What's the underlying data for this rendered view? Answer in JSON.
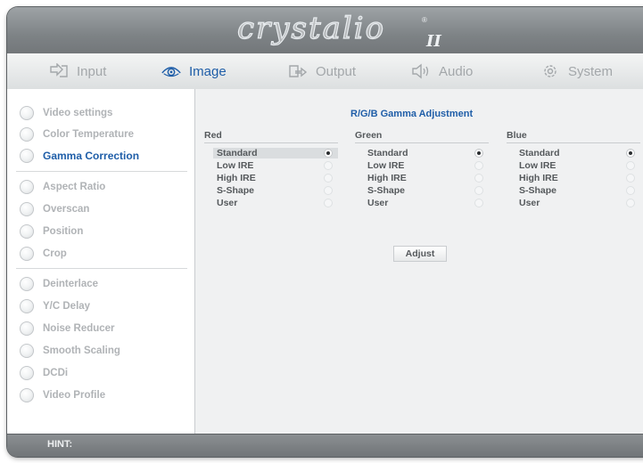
{
  "brand": {
    "logo": "crystalio",
    "logo_mark": "®",
    "logo_sub": "II"
  },
  "tabs": [
    {
      "label": "Input",
      "icon": "input-icon",
      "active": false
    },
    {
      "label": "Image",
      "icon": "eye-icon",
      "active": true
    },
    {
      "label": "Output",
      "icon": "output-icon",
      "active": false
    },
    {
      "label": "Audio",
      "icon": "speaker-icon",
      "active": false
    },
    {
      "label": "System",
      "icon": "gear-icon",
      "active": false
    }
  ],
  "sidebar": {
    "items": [
      {
        "label": "Video settings",
        "active": false
      },
      {
        "label": "Color Temperature",
        "active": false
      },
      {
        "label": "Gamma Correction",
        "active": true
      },
      {
        "label": "Aspect Ratio",
        "active": false
      },
      {
        "label": "Overscan",
        "active": false
      },
      {
        "label": "Position",
        "active": false
      },
      {
        "label": "Crop",
        "active": false
      },
      {
        "label": "Deinterlace",
        "active": false
      },
      {
        "label": "Y/C Delay",
        "active": false
      },
      {
        "label": "Noise Reducer",
        "active": false
      },
      {
        "label": "Smooth Scaling",
        "active": false
      },
      {
        "label": "DCDi",
        "active": false
      },
      {
        "label": "Video Profile",
        "active": false
      }
    ]
  },
  "main": {
    "title": "R/G/B Gamma Adjustment",
    "columns": [
      {
        "heading": "Red",
        "options": [
          "Standard",
          "Low IRE",
          "High IRE",
          "S-Shape",
          "User"
        ],
        "selected": "Standard"
      },
      {
        "heading": "Green",
        "options": [
          "Standard",
          "Low IRE",
          "High IRE",
          "S-Shape",
          "User"
        ],
        "selected": "Standard"
      },
      {
        "heading": "Blue",
        "options": [
          "Standard",
          "Low IRE",
          "High IRE",
          "S-Shape",
          "User"
        ],
        "selected": "Standard"
      }
    ],
    "adjust_label": "Adjust"
  },
  "hint": {
    "label": "HINT:"
  },
  "colors": {
    "accent": "#1f5ea8",
    "inactive_text": "#b0b3b6",
    "frame": "#7e8386"
  }
}
